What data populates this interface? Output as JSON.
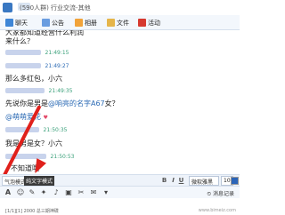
{
  "window": {
    "title_visible": "(590人群) 行业交流-其他"
  },
  "toolbar": {
    "items": [
      {
        "label": "聊天",
        "icon": "chat-icon"
      },
      {
        "label": "公告",
        "icon": "notice-icon"
      },
      {
        "label": "相册",
        "icon": "album-icon"
      },
      {
        "label": "文件",
        "icon": "file-icon"
      },
      {
        "label": "活动",
        "icon": "flag-icon"
      }
    ]
  },
  "messages": [
    {
      "text": "大家都知道经营什么利润",
      "time": ""
    },
    {
      "text": "来什么？",
      "time": ""
    },
    {
      "text": "",
      "time": "21:49:15"
    },
    {
      "text": "",
      "time": "21:49:27"
    },
    {
      "text": "那么多红包，小六",
      "time": ""
    },
    {
      "text": "",
      "time": "21:49:35"
    },
    {
      "text": "先说你是男是",
      "mention": "@响亮的名字A67",
      "text_after": "女？",
      "time": ""
    },
    {
      "text": "",
      "mention": "@萌萌爱花",
      "time": "",
      "heart": "♥"
    },
    {
      "text": "",
      "time": "21:50:35"
    },
    {
      "text": "我是男是女？小六",
      "time": ""
    },
    {
      "text": "",
      "time": "21:50:53"
    },
    {
      "text": "不知道哦",
      "time": ""
    }
  ],
  "format_bar": {
    "tab_bubble": "气泡模式",
    "tab_plain": "纯文字模式",
    "font_select": "微软雅黑",
    "size_select": "10",
    "bold": "B",
    "italic": "I",
    "underline": "U"
  },
  "input_bar": {
    "message_record": "消息记录"
  },
  "status": {
    "left_text": "[1/1][1]  2000 总三期神碟",
    "watermark": "www.bimeiz.com"
  },
  "colors": {
    "accent": "#2c6bb5",
    "arrow": "#e0201b",
    "timestamp": "#3aa07a"
  }
}
